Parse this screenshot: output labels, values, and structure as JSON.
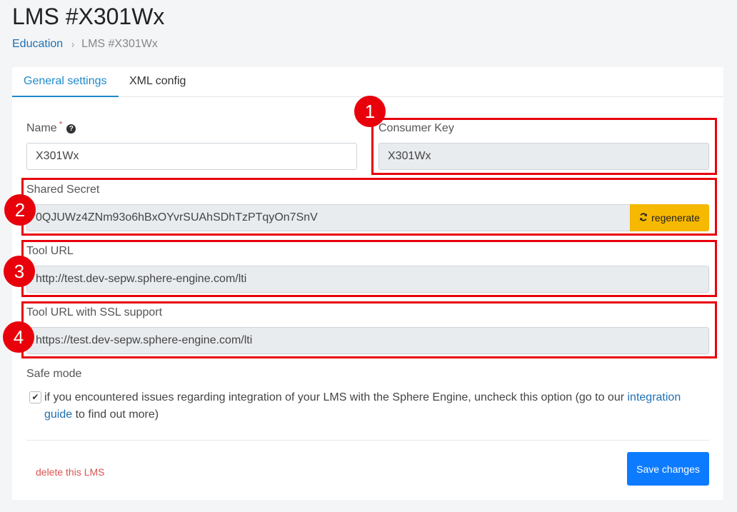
{
  "page": {
    "title": "LMS #X301Wx",
    "breadcrumb": {
      "parent": "Education",
      "separator": "›",
      "current": "LMS #X301Wx"
    }
  },
  "tabs": [
    {
      "label": "General settings",
      "active": true
    },
    {
      "label": "XML config",
      "active": false
    }
  ],
  "form": {
    "name": {
      "label": "Name",
      "required_mark": "*",
      "help_icon": "?",
      "value": "X301Wx"
    },
    "consumer_key": {
      "label": "Consumer Key",
      "value": "X301Wx"
    },
    "shared_secret": {
      "label": "Shared Secret",
      "value": "0QJUWz4ZNm93o6hBxOYvrSUAhSDhTzPTqyOn7SnV",
      "regenerate_label": "regenerate",
      "regenerate_icon": "sync-icon"
    },
    "tool_url": {
      "label": "Tool URL",
      "value": "http://test.dev-sepw.sphere-engine.com/lti"
    },
    "tool_url_ssl": {
      "label": "Tool URL with SSL support",
      "value": "https://test.dev-sepw.sphere-engine.com/lti"
    },
    "safe_mode": {
      "label": "Safe mode",
      "checked": true,
      "checkmark": "✔",
      "text_before": "if you encountered issues regarding integration of your LMS with the Sphere Engine, uncheck this option (go to our ",
      "link_text": "integration guide",
      "text_after": " to find out more)"
    }
  },
  "annotations": [
    "1",
    "2",
    "3",
    "4"
  ],
  "footer": {
    "delete_label": "delete this LMS",
    "save_label": "Save changes"
  },
  "colors": {
    "accent": "#1f8acb",
    "highlight": "#e8000b",
    "regenerate": "#f7b900",
    "save": "#0d7bff",
    "danger": "#d9534f"
  }
}
